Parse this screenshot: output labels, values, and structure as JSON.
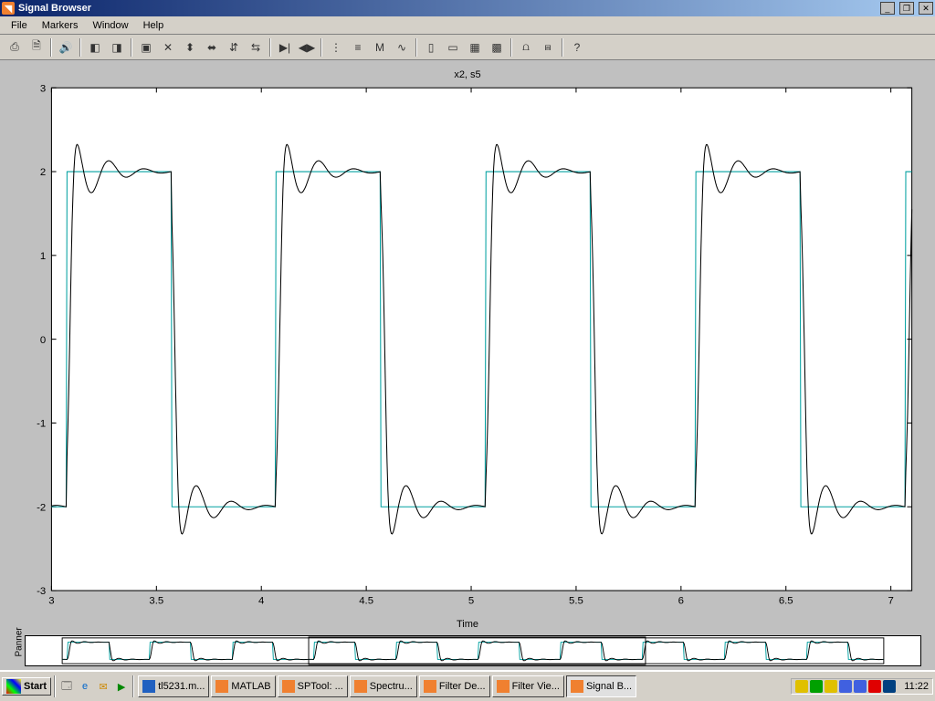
{
  "title": "Signal Browser",
  "window": {
    "min": "_",
    "max": "❐",
    "close": "✕"
  },
  "menu": [
    "File",
    "Markers",
    "Window",
    "Help"
  ],
  "toolbar_icons": [
    "print-icon",
    "preview-icon",
    "|",
    "sound-icon",
    "|",
    "select-left-icon",
    "select-right-icon",
    "|",
    "box-icon",
    "fullzoom-icon",
    "zoomin-y-icon",
    "zoomout-y-icon",
    "zoominx-icon",
    "zoomoutx-icon",
    "|",
    "marker-left-icon",
    "marker-right-icon",
    "|",
    "vert-marker-icon",
    "horz-marker-icon",
    "track-icon",
    "slope-icon",
    "|",
    "align-left-icon",
    "align-center-icon",
    "align-num-icon",
    "align-grid-icon",
    "|",
    "fft1-icon",
    "fft2-icon",
    "|",
    "help-icon"
  ],
  "chart_title": "x2, s5",
  "xlabel": "Time",
  "panner_label": "Panner",
  "chart_data": {
    "type": "line",
    "xlim": [
      3,
      7.1
    ],
    "ylim": [
      -3,
      3
    ],
    "xticks": [
      3,
      3.5,
      4,
      4.5,
      5,
      5.5,
      6,
      6.5,
      7
    ],
    "yticks": [
      -3,
      -2,
      -1,
      0,
      1,
      2,
      3
    ],
    "series": [
      {
        "name": "s5",
        "kind": "square",
        "color": "#00a0a0",
        "period": 1.0,
        "phase": 0.07,
        "low": -2,
        "high": 2
      },
      {
        "name": "x2",
        "kind": "filtered",
        "color": "#000000",
        "period": 1.0,
        "phase": 0.07,
        "low": -2,
        "high": 2,
        "overshoot": 0.67,
        "ring_freq": 6.0,
        "decay": 8.0
      }
    ]
  },
  "panner_data": {
    "xlim_full": [
      0,
      10
    ],
    "view": [
      3,
      7.1
    ]
  },
  "taskbar": {
    "start": "Start",
    "quick": [
      "desktop-icon",
      "ie-icon",
      "outlook-icon",
      "media-icon"
    ],
    "tasks": [
      {
        "label": "tl5231.m...",
        "icon": "word",
        "active": false
      },
      {
        "label": "MATLAB",
        "icon": "matlab",
        "active": false
      },
      {
        "label": "SPTool: ...",
        "icon": "matlab",
        "active": false
      },
      {
        "label": "Spectru...",
        "icon": "matlab",
        "active": false
      },
      {
        "label": "Filter De...",
        "icon": "matlab",
        "active": false
      },
      {
        "label": "Filter Vie...",
        "icon": "matlab",
        "active": false
      },
      {
        "label": "Signal B...",
        "icon": "matlab",
        "active": true
      }
    ],
    "tray": [
      "vol-icon",
      "net1-icon",
      "batt-icon",
      "disp-icon",
      "net2-icon",
      "av-icon",
      "arrow-icon"
    ],
    "clock": "11:22"
  }
}
